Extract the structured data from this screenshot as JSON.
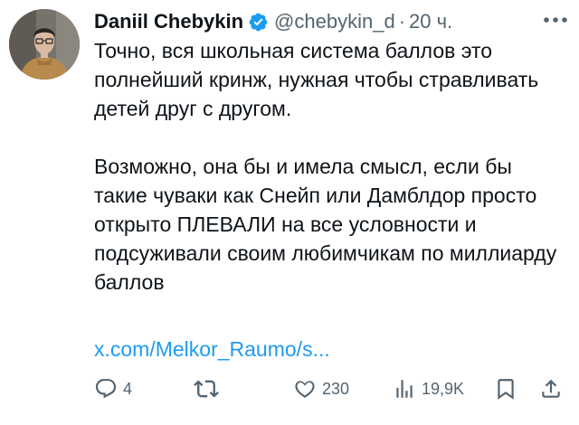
{
  "tweet": {
    "author_name": "Daniil Chebykin",
    "handle": "@chebykin_d",
    "separator": "·",
    "time": "20 ч.",
    "paragraphs": [
      "Точно, вся школьная система баллов это полнейший кринж, нужная чтобы стравливать детей друг с другом.",
      "Возможно, она бы и имела смысл, если бы такие чуваки как Снейп или Дамблдор просто открыто ПЛЕВАЛИ на все условности и подсуживали своим любимчикам по миллиарду баллов"
    ],
    "link": "x.com/Melkor_Raumo/s..."
  },
  "actions": {
    "replies": "4",
    "retweets": "",
    "likes": "230",
    "views": "19,9K"
  },
  "icons": {
    "verified": "verified-badge-icon",
    "more": "more-dots-icon",
    "reply": "reply-icon",
    "retweet": "retweet-icon",
    "like": "heart-icon",
    "views": "views-icon",
    "bookmark": "bookmark-icon",
    "share": "share-icon"
  },
  "colors": {
    "text": "#0f1419",
    "secondary": "#536471",
    "link": "#1d9bf0",
    "verified": "#1d9bf0"
  }
}
